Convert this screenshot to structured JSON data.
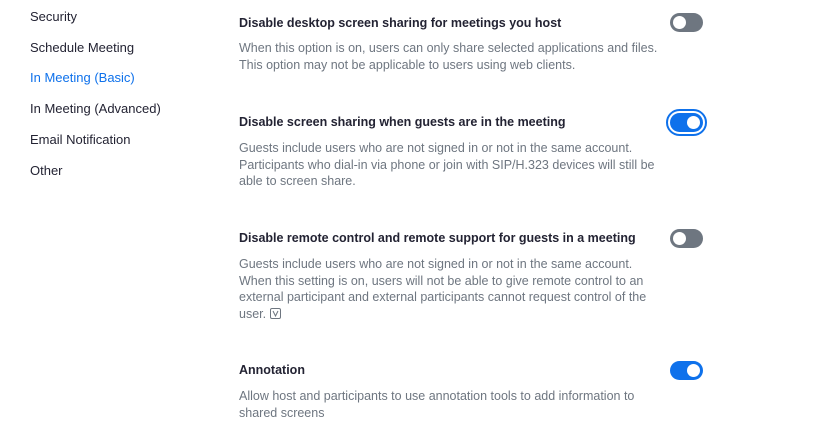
{
  "sidebar": {
    "items": [
      {
        "label": "Security",
        "active": false
      },
      {
        "label": "Schedule Meeting",
        "active": false
      },
      {
        "label": "In Meeting (Basic)",
        "active": true
      },
      {
        "label": "In Meeting (Advanced)",
        "active": false
      },
      {
        "label": "Email Notification",
        "active": false
      },
      {
        "label": "Other",
        "active": false
      }
    ]
  },
  "settings": [
    {
      "title": "Disable desktop screen sharing for meetings you host",
      "description": "When this option is on, users can only share selected applications and files. This option may not be applicable to users using web clients.",
      "enabled": false
    },
    {
      "title": "Disable screen sharing when guests are in the meeting",
      "description": "Guests include users who are not signed in or not in the same account. Participants who dial-in via phone or join with SIP/H.323 devices will still be able to screen share.",
      "enabled": true
    },
    {
      "title": "Disable remote control and remote support for guests in a meeting",
      "description": "Guests include users who are not signed in or not in the same account. When this setting is on, users will not be able to give remote control to an external participant and external participants cannot request control of the user.",
      "enabled": false,
      "icon": "version-icon"
    },
    {
      "title": "Annotation",
      "description": "Allow host and participants to use annotation tools to add information to shared screens",
      "enabled": true
    }
  ],
  "colors": {
    "accent": "#0e71eb",
    "toggle_off": "#6e7680",
    "text_primary": "#232333",
    "text_secondary": "#6e7680"
  }
}
